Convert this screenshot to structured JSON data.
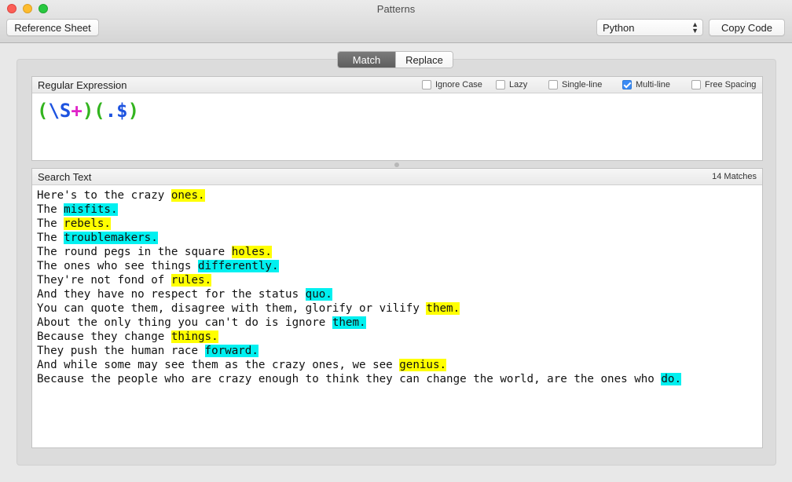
{
  "window": {
    "title": "Patterns"
  },
  "toolbar": {
    "reference_label": "Reference Sheet",
    "language": "Python",
    "copy_label": "Copy Code"
  },
  "mode_tabs": {
    "match_label": "Match",
    "replace_label": "Replace",
    "selected": "Match"
  },
  "regex_panel": {
    "header": "Regular Expression",
    "options": [
      {
        "label": "Ignore Case",
        "checked": false
      },
      {
        "label": "Lazy",
        "checked": false
      },
      {
        "label": "Single-line",
        "checked": false
      },
      {
        "label": "Multi-line",
        "checked": true
      },
      {
        "label": "Free Spacing",
        "checked": false
      }
    ],
    "pattern_tokens": [
      {
        "text": "(",
        "kind": "paren"
      },
      {
        "text": "\\S",
        "kind": "class"
      },
      {
        "text": "+",
        "kind": "quant"
      },
      {
        "text": ")",
        "kind": "paren"
      },
      {
        "text": "(",
        "kind": "paren"
      },
      {
        "text": ".",
        "kind": "class"
      },
      {
        "text": "$",
        "kind": "class"
      },
      {
        "text": ")",
        "kind": "paren"
      }
    ]
  },
  "search_panel": {
    "header": "Search Text",
    "match_count": "14 Matches",
    "lines": [
      {
        "pre": "Here's to the crazy ",
        "match": "ones.",
        "color": "yellow"
      },
      {
        "pre": "The ",
        "match": "misfits.",
        "color": "cyan"
      },
      {
        "pre": "The ",
        "match": "rebels.",
        "color": "yellow"
      },
      {
        "pre": "The ",
        "match": "troublemakers.",
        "color": "cyan"
      },
      {
        "pre": "The round pegs in the square ",
        "match": "holes.",
        "color": "yellow"
      },
      {
        "pre": "The ones who see things ",
        "match": "differently.",
        "color": "cyan"
      },
      {
        "pre": "They're not fond of ",
        "match": "rules.",
        "color": "yellow"
      },
      {
        "pre": "And they have no respect for the status ",
        "match": "quo.",
        "color": "cyan"
      },
      {
        "pre": "You can quote them, disagree with them, glorify or vilify ",
        "match": "them.",
        "color": "yellow"
      },
      {
        "pre": "About the only thing you can't do is ignore ",
        "match": "them.",
        "color": "cyan"
      },
      {
        "pre": "Because they change ",
        "match": "things.",
        "color": "yellow"
      },
      {
        "pre": "They push the human race ",
        "match": "forward.",
        "color": "cyan"
      },
      {
        "pre": "And while some may see them as the crazy ones, we see ",
        "match": "genius.",
        "color": "yellow"
      },
      {
        "pre": "Because the people who are crazy enough to think they can change the world, are the ones who ",
        "match": "do.",
        "color": "cyan"
      }
    ]
  },
  "colors": {
    "match_yellow": "#ffff00",
    "match_cyan": "#00f0f0",
    "regex_paren": "#33b41f",
    "regex_class": "#1d53e0",
    "regex_quant": "#e021c8"
  }
}
